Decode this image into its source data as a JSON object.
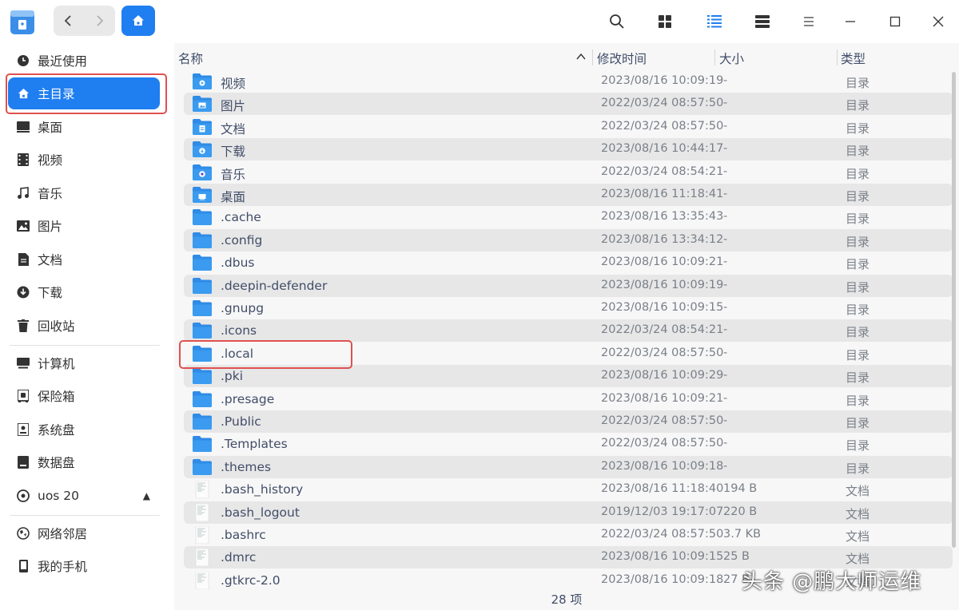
{
  "sidebar": {
    "items": [
      {
        "label": "最近使用",
        "icon": "clock-icon"
      },
      {
        "label": "主目录",
        "icon": "home-icon",
        "active": true
      },
      {
        "label": "桌面",
        "icon": "desktop-icon"
      },
      {
        "label": "视频",
        "icon": "video-icon"
      },
      {
        "label": "音乐",
        "icon": "music-icon"
      },
      {
        "label": "图片",
        "icon": "picture-icon"
      },
      {
        "label": "文档",
        "icon": "document-icon"
      },
      {
        "label": "下载",
        "icon": "download-icon"
      },
      {
        "label": "回收站",
        "icon": "trash-icon"
      },
      {
        "label": "计算机",
        "icon": "computer-icon"
      },
      {
        "label": "保险箱",
        "icon": "vault-icon"
      },
      {
        "label": "系统盘",
        "icon": "disk-icon"
      },
      {
        "label": "数据盘",
        "icon": "disk-icon"
      },
      {
        "label": "uos 20",
        "icon": "optical-disc-icon"
      },
      {
        "label": "网络邻居",
        "icon": "network-icon"
      },
      {
        "label": "我的手机",
        "icon": "phone-icon"
      }
    ]
  },
  "columns": {
    "name": "名称",
    "modified": "修改时间",
    "size": "大小",
    "type": "类型"
  },
  "files": [
    {
      "name": "视频",
      "date": "2023/08/16 10:09:19",
      "size": "-",
      "type": "目录",
      "kind": "video-folder"
    },
    {
      "name": "图片",
      "date": "2022/03/24 08:57:50",
      "size": "-",
      "type": "目录",
      "kind": "picture-folder"
    },
    {
      "name": "文档",
      "date": "2022/03/24 08:57:50",
      "size": "-",
      "type": "目录",
      "kind": "document-folder"
    },
    {
      "name": "下载",
      "date": "2023/08/16 10:44:17",
      "size": "-",
      "type": "目录",
      "kind": "download-folder"
    },
    {
      "name": "音乐",
      "date": "2022/03/24 08:54:21",
      "size": "-",
      "type": "目录",
      "kind": "music-folder"
    },
    {
      "name": "桌面",
      "date": "2023/08/16 11:18:41",
      "size": "-",
      "type": "目录",
      "kind": "desktop-folder"
    },
    {
      "name": ".cache",
      "date": "2023/08/16 13:35:43",
      "size": "-",
      "type": "目录",
      "kind": "folder"
    },
    {
      "name": ".config",
      "date": "2023/08/16 13:34:12",
      "size": "-",
      "type": "目录",
      "kind": "folder"
    },
    {
      "name": ".dbus",
      "date": "2023/08/16 10:09:21",
      "size": "-",
      "type": "目录",
      "kind": "folder"
    },
    {
      "name": ".deepin-defender",
      "date": "2023/08/16 10:09:19",
      "size": "-",
      "type": "目录",
      "kind": "folder"
    },
    {
      "name": ".gnupg",
      "date": "2023/08/16 10:09:15",
      "size": "-",
      "type": "目录",
      "kind": "folder"
    },
    {
      "name": ".icons",
      "date": "2022/03/24 08:54:21",
      "size": "-",
      "type": "目录",
      "kind": "folder"
    },
    {
      "name": ".local",
      "date": "2022/03/24 08:57:50",
      "size": "-",
      "type": "目录",
      "kind": "folder"
    },
    {
      "name": ".pki",
      "date": "2023/08/16 10:09:29",
      "size": "-",
      "type": "目录",
      "kind": "folder"
    },
    {
      "name": ".presage",
      "date": "2023/08/16 10:09:21",
      "size": "-",
      "type": "目录",
      "kind": "folder"
    },
    {
      "name": ".Public",
      "date": "2022/03/24 08:57:50",
      "size": "-",
      "type": "目录",
      "kind": "folder"
    },
    {
      "name": ".Templates",
      "date": "2022/03/24 08:57:50",
      "size": "-",
      "type": "目录",
      "kind": "folder"
    },
    {
      "name": ".themes",
      "date": "2023/08/16 10:09:18",
      "size": "-",
      "type": "目录",
      "kind": "folder"
    },
    {
      "name": ".bash_history",
      "date": "2023/08/16 11:18:40",
      "size": "194 B",
      "type": "文档",
      "kind": "text-file"
    },
    {
      "name": ".bash_logout",
      "date": "2019/12/03 19:17:07",
      "size": "220 B",
      "type": "文档",
      "kind": "text-file"
    },
    {
      "name": ".bashrc",
      "date": "2022/03/24 08:57:50",
      "size": "3.7 KB",
      "type": "文档",
      "kind": "text-file"
    },
    {
      "name": ".dmrc",
      "date": "2023/08/16 10:09:15",
      "size": "25 B",
      "type": "文档",
      "kind": "text-file"
    },
    {
      "name": ".gtkrc-2.0",
      "date": "2023/08/16 10:09:18",
      "size": "27 B",
      "type": "文档",
      "kind": "text-file"
    }
  ],
  "status": {
    "count": "28 项"
  },
  "watermark": "头条 @鹏大师运维",
  "colors": {
    "accent": "#1f7ef0",
    "highlight_box": "#e05050",
    "folder": "#3a9bf0"
  }
}
